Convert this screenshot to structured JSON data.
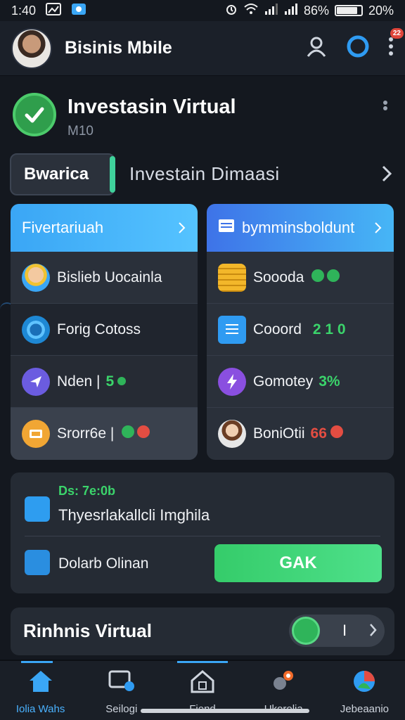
{
  "status_bar": {
    "time": "1:40",
    "battery_text": "86%",
    "extra_percent": "20%",
    "battery_level": 0.86
  },
  "app_bar": {
    "title": "Bisinis Mbile",
    "notification_badge": "22"
  },
  "hero": {
    "title": "Investasin Virtual",
    "subtitle": "M10"
  },
  "tabs": {
    "active": "Bwarica",
    "second": "Investain Dimaasi"
  },
  "panel_left": {
    "header": "Fivertariuah",
    "rows": [
      {
        "label": "Bislieb Uocainla",
        "value": ""
      },
      {
        "label": "Forig Cotoss",
        "value": ""
      },
      {
        "label": "Nden |",
        "value": "5"
      },
      {
        "label": "Srorr6e |",
        "value": ""
      }
    ]
  },
  "panel_right": {
    "header": "bymminsboldunt",
    "rows": [
      {
        "label": "Soooda",
        "value": ""
      },
      {
        "label": "Cooord",
        "value": "2 1 0"
      },
      {
        "label": "Gomotey",
        "value": "3%"
      },
      {
        "label": "BoniOtii",
        "value": "66"
      }
    ]
  },
  "action_card": {
    "label": "Ds: 7e:0b",
    "title": "Thyesrlakallcli Imghila",
    "row2": "Dolarb Olinan",
    "button": "GAK"
  },
  "footer_card": {
    "title": "Rinhnis Virtual",
    "toggle_label": "I"
  },
  "bottom_nav": [
    {
      "label": "Iolia Wahs",
      "icon": "home-icon"
    },
    {
      "label": "Seilogi",
      "icon": "chat-monitor-icon"
    },
    {
      "label": "Fiend",
      "icon": "house-outline-icon"
    },
    {
      "label": "Ukorolia",
      "icon": "person-pin-icon"
    },
    {
      "label": "Jebeaanio",
      "icon": "globe-icon"
    }
  ],
  "colors": {
    "accent": "#3aa6f5",
    "green": "#3bd46b",
    "red": "#e34d42",
    "background": "#14181f"
  }
}
